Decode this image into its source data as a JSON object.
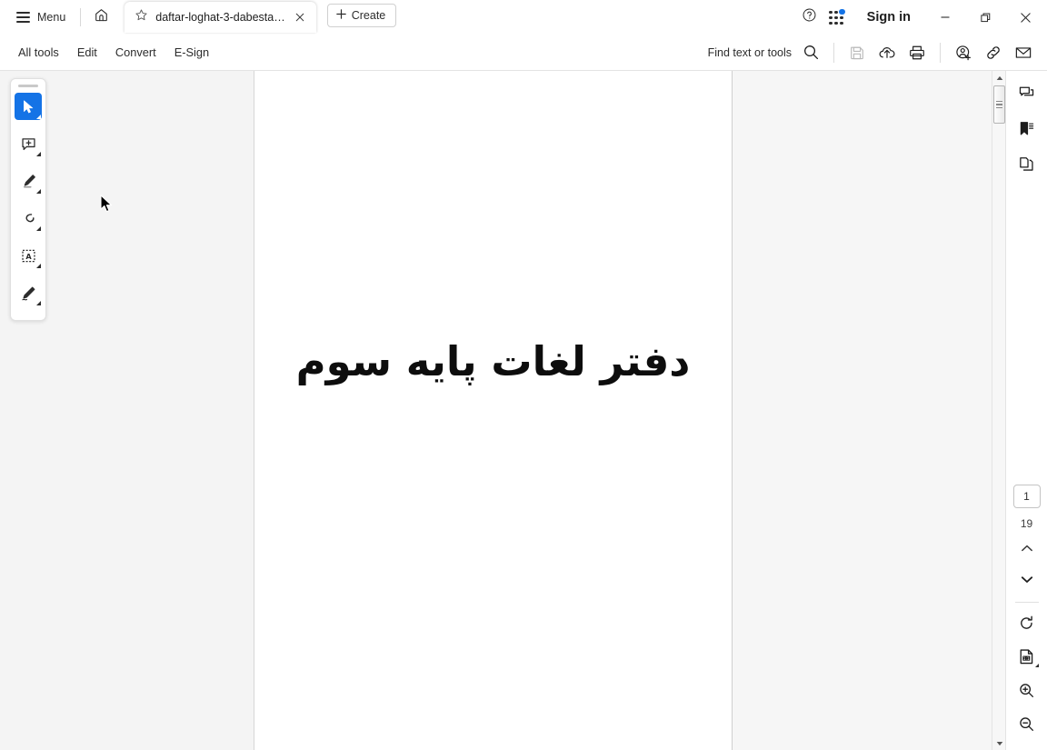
{
  "titlebar": {
    "menu_label": "Menu",
    "home_icon": "home-icon",
    "tab": {
      "favicon": "star-icon",
      "title": "daftar-loghat-3-dabesta…",
      "close_icon": "close-icon"
    },
    "create_label": "Create",
    "help_icon": "help-circle-icon",
    "apps_icon": "app-grid-icon",
    "signin_label": "Sign in",
    "minimize_icon": "minimize-icon",
    "restore_icon": "restore-icon",
    "close_icon": "window-close-icon"
  },
  "menubar": {
    "items": [
      {
        "label": "All tools"
      },
      {
        "label": "Edit"
      },
      {
        "label": "Convert"
      },
      {
        "label": "E-Sign"
      }
    ],
    "find_label": "Find text or tools",
    "search_icon": "search-icon",
    "tools": [
      {
        "name": "save-icon",
        "disabled": true
      },
      {
        "name": "cloud-upload-icon",
        "disabled": false
      },
      {
        "name": "print-icon",
        "disabled": false
      },
      {
        "name": "add-person-icon",
        "disabled": false
      },
      {
        "name": "link-icon",
        "disabled": false
      },
      {
        "name": "email-icon",
        "disabled": false
      }
    ]
  },
  "tool_panel": {
    "tools": [
      {
        "name": "select-tool",
        "icon": "cursor-arrow-icon",
        "active": true
      },
      {
        "name": "comment-tool",
        "icon": "add-comment-icon",
        "active": false
      },
      {
        "name": "highlight-tool",
        "icon": "highlighter-icon",
        "active": false
      },
      {
        "name": "draw-tool",
        "icon": "lasso-draw-icon",
        "active": false
      },
      {
        "name": "add-text-tool",
        "icon": "text-box-icon",
        "active": false
      },
      {
        "name": "sign-tool",
        "icon": "signature-pen-icon",
        "active": false
      }
    ]
  },
  "document": {
    "page_text": "دفتر لغات پایه سوم"
  },
  "right_rail": {
    "top_icons": [
      {
        "name": "comments-panel-icon"
      },
      {
        "name": "bookmarks-panel-icon"
      },
      {
        "name": "page-thumbnails-icon"
      }
    ],
    "current_page": "1",
    "total_pages": "19",
    "prev_icon": "chevron-up-icon",
    "next_icon": "chevron-down-icon",
    "bottom_icons": [
      {
        "name": "rotate-icon"
      },
      {
        "name": "fit-page-icon"
      },
      {
        "name": "zoom-in-icon"
      },
      {
        "name": "zoom-out-icon"
      }
    ]
  },
  "scrollbar": {
    "up_icon": "scroll-up-icon",
    "down_icon": "scroll-down-icon"
  },
  "colors": {
    "accent": "#1473e6",
    "rail_bg": "#f4f4f4",
    "page_bg": "#ffffff",
    "viewport_bg": "#f6f6f6"
  }
}
